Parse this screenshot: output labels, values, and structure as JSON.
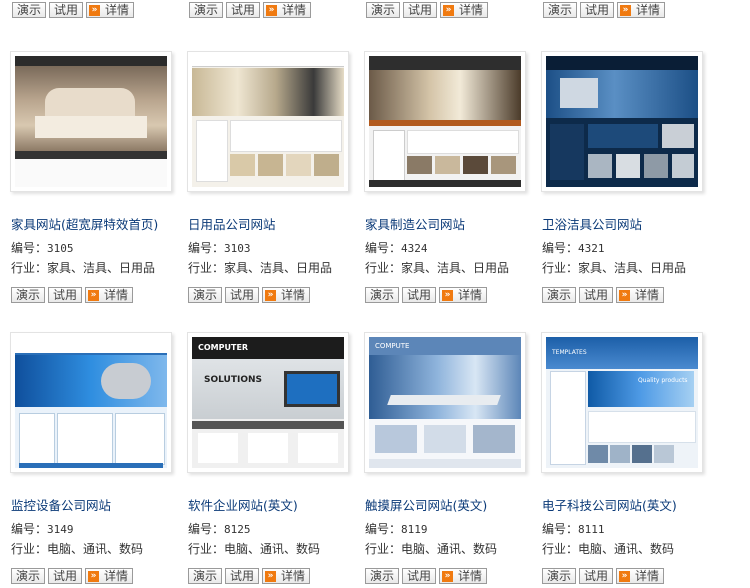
{
  "buttons": {
    "demo": "演示",
    "trial": "试用",
    "details": "详情"
  },
  "labels": {
    "code": "编号",
    "industry": "行业"
  },
  "top_row_partial": [
    {},
    {},
    {},
    {}
  ],
  "products": [
    {
      "title": "家具网站(超宽屏特效首页)",
      "code": "3105",
      "industry": "家具、洁具、日用品"
    },
    {
      "title": "日用品公司网站",
      "code": "3103",
      "industry": "家具、洁具、日用品"
    },
    {
      "title": "家具制造公司网站",
      "code": "4324",
      "industry": "家具、洁具、日用品"
    },
    {
      "title": "卫浴洁具公司网站",
      "code": "4321",
      "industry": "家具、洁具、日用品"
    },
    {
      "title": "监控设备公司网站",
      "code": "3149",
      "industry": "电脑、通讯、数码"
    },
    {
      "title": "软件企业网站(英文)",
      "code": "8125",
      "industry": "电脑、通讯、数码"
    },
    {
      "title": "触摸屏公司网站(英文)",
      "code": "8119",
      "industry": "电脑、通讯、数码"
    },
    {
      "title": "电子科技公司网站(英文)",
      "code": "8111",
      "industry": "电脑、通讯、数码"
    }
  ],
  "thumbnail_text": {
    "computer_logo": "COMPUTER",
    "solutions": "SOLUTIONS",
    "compute": "COMPUTE",
    "templates": "TEMPLATES",
    "quality": "Quality products"
  }
}
